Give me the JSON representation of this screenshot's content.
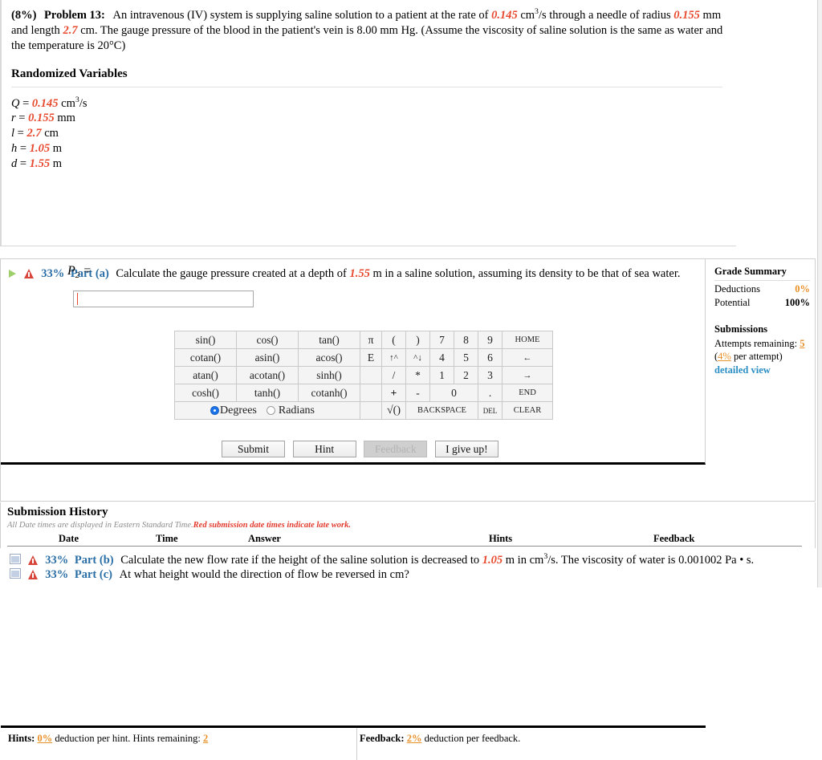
{
  "problem": {
    "weight": "(8%)",
    "label": "Problem 13:",
    "text_1": "An intravenous (IV) system is supplying saline solution to a patient at the rate of",
    "rate": "0.145",
    "text_2": "cm",
    "rate_unit_sup": "3",
    "text_3": "/s through a needle of radius",
    "radius": "0.155",
    "text_4": "mm and length",
    "length": "2.7",
    "text_5": "cm. The gauge pressure of the blood in the patient's vein is 8.00 mm Hg. (Assume the viscosity of saline solution is the same as water and the temperature is 20°C)"
  },
  "randomized": {
    "heading": "Randomized Variables",
    "vars": [
      {
        "sym": "Q",
        "val": "0.145",
        "unit": "cm",
        "sup": "3",
        "unit_tail": "/s"
      },
      {
        "sym": "r",
        "val": "0.155",
        "unit": "mm",
        "sup": "",
        "unit_tail": ""
      },
      {
        "sym": "l",
        "val": "2.7",
        "unit": "cm",
        "sup": "",
        "unit_tail": ""
      },
      {
        "sym": "h",
        "val": "1.05",
        "unit": "m",
        "sup": "",
        "unit_tail": ""
      },
      {
        "sym": "d",
        "val": "1.55",
        "unit": "m",
        "sup": "",
        "unit_tail": ""
      }
    ]
  },
  "part_a": {
    "percent": "33%",
    "label": "Part (a)",
    "text_1": "Calculate the gauge pressure created at a depth of",
    "depth": "1.55",
    "text_2": "m in a saline solution, assuming its density to be that of sea water.",
    "answer_label": "P",
    "answer_sub": "2",
    "answer_eq": "=",
    "answer_value": "",
    "answer_placeholder": ""
  },
  "calculator": {
    "functions": [
      [
        "sin()",
        "cos()",
        "tan()"
      ],
      [
        "cotan()",
        "asin()",
        "acos()"
      ],
      [
        "atan()",
        "acotan()",
        "sinh()"
      ],
      [
        "cosh()",
        "tanh()",
        "cotanh()"
      ]
    ],
    "constants": [
      "π",
      "E",
      "",
      "",
      ""
    ],
    "keys_row1": [
      "(",
      ")",
      "7",
      "8",
      "9",
      "HOME"
    ],
    "keys_row2": [
      "↑^",
      "^↓",
      "4",
      "5",
      "6",
      "←"
    ],
    "keys_row3": [
      "/",
      "*",
      "1",
      "2",
      "3",
      "→"
    ],
    "keys_row4": [
      "+",
      "-",
      "0",
      ".",
      "END"
    ],
    "keys_row5": [
      "√()",
      "BACKSPACE",
      "DEL",
      "CLEAR"
    ],
    "degrees_label": "Degrees",
    "radians_label": "Radians",
    "angle_mode": "Degrees"
  },
  "actions": {
    "submit": "Submit",
    "hint": "Hint",
    "feedback": "Feedback",
    "give_up": "I give up!"
  },
  "grade_summary": {
    "heading": "Grade Summary",
    "deductions_label": "Deductions",
    "deductions_value": "0%",
    "potential_label": "Potential",
    "potential_value": "100%",
    "submissions_heading": "Submissions",
    "attempts_label": "Attempts remaining:",
    "attempts_value": "5",
    "per_attempt": "(4% per attempt)",
    "per_attempt_pct": "4%",
    "per_attempt_tail": "per attempt)",
    "detailed_view": "detailed view"
  },
  "hints_bar": {
    "hints_label": "Hints:",
    "hints_pct": "0%",
    "hints_text": "deduction per hint. Hints remaining:",
    "hints_remaining": "2",
    "feedback_label": "Feedback:",
    "feedback_pct": "2%",
    "feedback_text": "deduction per feedback."
  },
  "submission_history": {
    "title": "Submission History",
    "note_1": "All Date times are displayed in Eastern Standard Time.",
    "note_2": "Red submission date times indicate late work.",
    "columns": [
      "Date",
      "Time",
      "Answer",
      "Hints",
      "Feedback"
    ],
    "rows": []
  },
  "part_b": {
    "percent": "33%",
    "label": "Part (b)",
    "text_1": "Calculate the new flow rate if the height of the saline solution is decreased to",
    "height": "1.05",
    "text_2": "m in cm",
    "sup": "3",
    "text_3": "/s. The viscosity of water is 0.001002 Pa • s."
  },
  "part_c": {
    "percent": "33%",
    "label": "Part (c)",
    "text_1": "At what height would the direction of flow be reversed in cm?"
  },
  "colors": {
    "highlight": "#e8492e",
    "orange": "#e8912a",
    "part_blue": "#2a6ea6",
    "link_blue": "#2a8fc4",
    "warning_red": "#d8453a",
    "play_green": "#9fcf6a"
  }
}
